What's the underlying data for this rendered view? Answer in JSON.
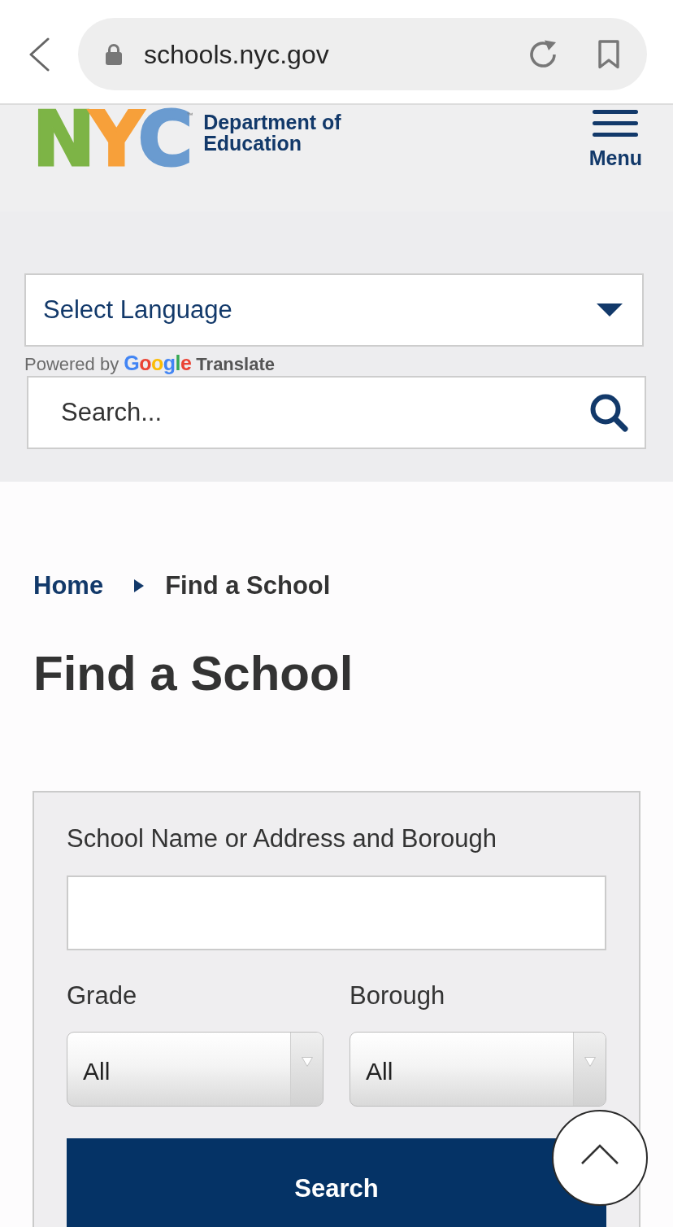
{
  "browser": {
    "url": "schools.nyc.gov"
  },
  "header": {
    "logo": {
      "letters": [
        {
          "text": "N",
          "color": "#7db446"
        },
        {
          "text": "Y",
          "color": "#f7a03a"
        },
        {
          "text": "C",
          "color": "#6a9bd0"
        }
      ],
      "trademark": "™",
      "department": [
        "Department of",
        "Education"
      ]
    },
    "menu": {
      "label": "Menu"
    }
  },
  "translate": {
    "language": {
      "value": "Select Language"
    },
    "powered_by": "Powered by",
    "brand": [
      {
        "text": "G",
        "color": "#4285f4"
      },
      {
        "text": "o",
        "color": "#ea4335"
      },
      {
        "text": "o",
        "color": "#fbbc05"
      },
      {
        "text": "g",
        "color": "#4285f4"
      },
      {
        "text": "l",
        "color": "#34a853"
      },
      {
        "text": "e",
        "color": "#ea4335"
      }
    ],
    "product": "Translate"
  },
  "site_search": {
    "placeholder": "Search..."
  },
  "breadcrumb": [
    {
      "label": "Home",
      "kind": "link"
    },
    {
      "label": "Find a School",
      "kind": "current"
    }
  ],
  "page_title": "Find a School",
  "school_search": {
    "name_field": {
      "label": "School Name or Address and Borough"
    },
    "filters": [
      {
        "label": "Grade",
        "value": "All"
      },
      {
        "label": "Borough",
        "value": "All"
      }
    ],
    "submit": "Search"
  }
}
